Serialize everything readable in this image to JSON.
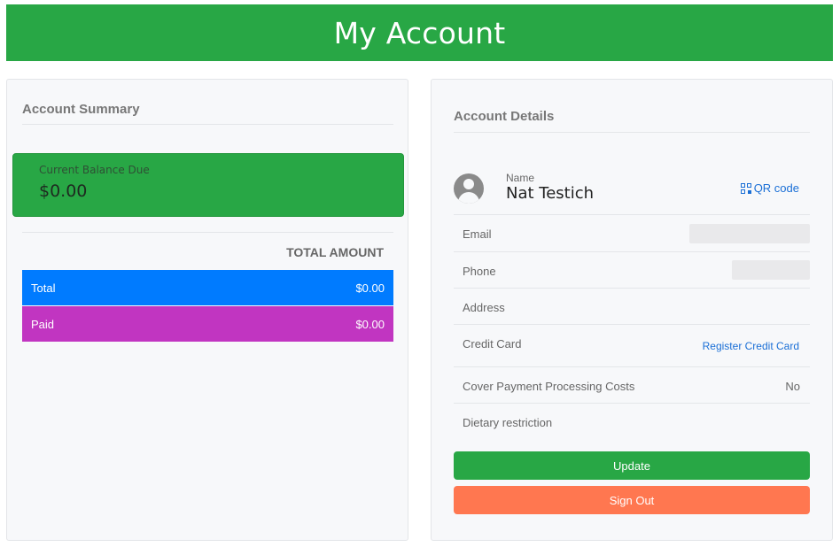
{
  "header": {
    "title": "My Account"
  },
  "summary": {
    "title": "Account Summary",
    "balance_label": "Current Balance Due",
    "balance_value": "$0.00",
    "total_header": "TOTAL AMOUNT",
    "rows": [
      {
        "label": "Total",
        "value": "$0.00",
        "color": "#007bff"
      },
      {
        "label": "Paid",
        "value": "$0.00",
        "color": "#c135c1"
      }
    ]
  },
  "details": {
    "title": "Account Details",
    "name_label": "Name",
    "name_value": "Nat Testich",
    "qr_label": "QR code",
    "fields": [
      {
        "label": "Email",
        "value": ""
      },
      {
        "label": "Phone",
        "value": ""
      },
      {
        "label": "Address",
        "value": ""
      },
      {
        "label": "Credit Card",
        "value": "Register Credit Card"
      },
      {
        "label": "Cover Payment Processing Costs",
        "value": "No"
      },
      {
        "label": "Dietary restriction",
        "value": ""
      }
    ],
    "update_label": "Update",
    "signout_label": "Sign Out"
  },
  "colors": {
    "primary_green": "#28a745",
    "blue": "#007bff",
    "magenta": "#c135c1",
    "orange": "#ff7750",
    "link": "#1a6fd6"
  }
}
